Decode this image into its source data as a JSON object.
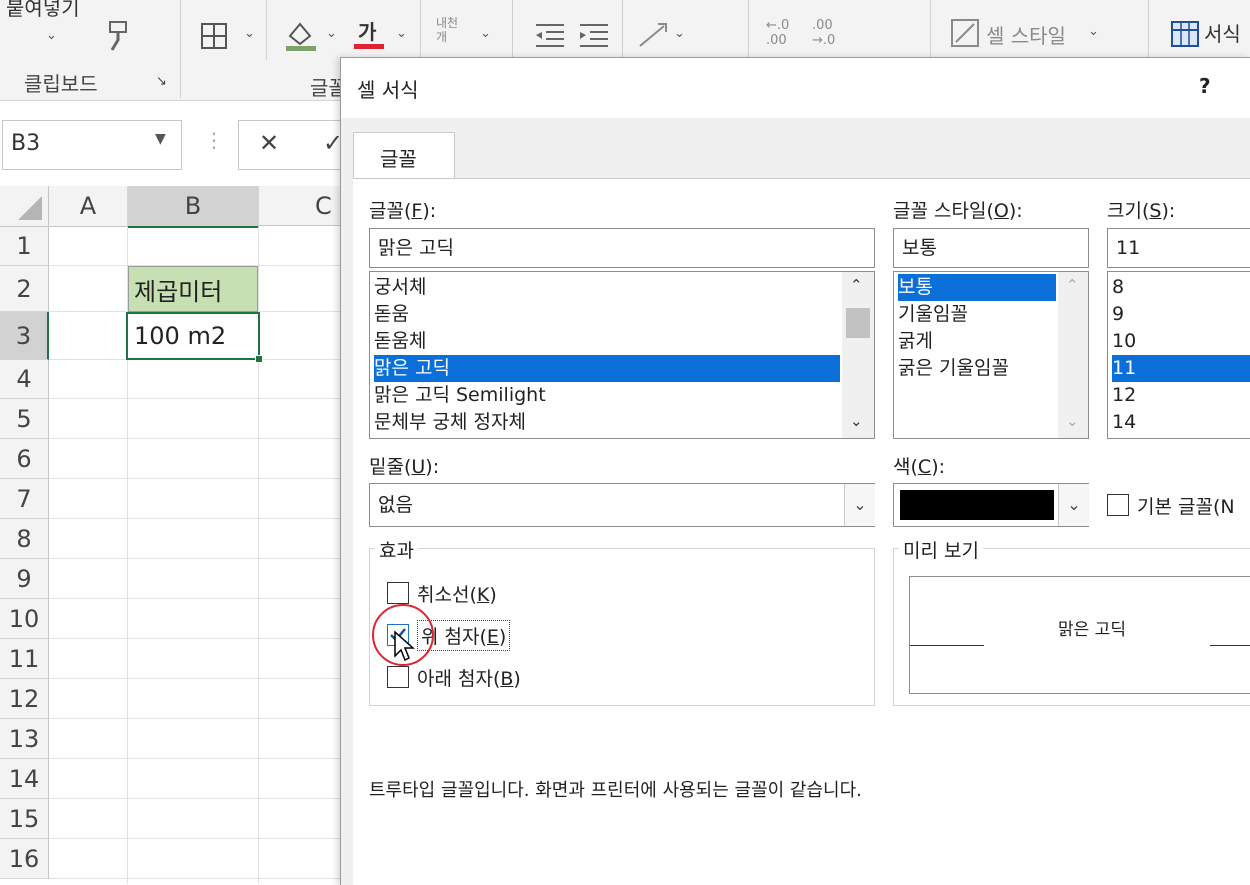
{
  "ribbon": {
    "paste_label": "붙여넣기",
    "clipboard_label": "클립보드",
    "font_group_label": "글꼴",
    "font_color_glyph": "가",
    "wrap_glyph": "내천\n개",
    "cell_style_label": "셀 스타일",
    "format_label": "서식",
    "dec_inc_top": "←.0",
    "dec_inc_bottom": ".00",
    "dec_dec_top": ".00",
    "dec_dec_bottom": "→.0"
  },
  "formula_bar": {
    "name_box": "B3",
    "cancel_glyph": "✕",
    "enter_glyph": "✓"
  },
  "sheet": {
    "columns": [
      "A",
      "B",
      "C"
    ],
    "rows": [
      "1",
      "2",
      "3",
      "4",
      "5",
      "6",
      "7",
      "8",
      "9",
      "10",
      "11",
      "12",
      "13",
      "14",
      "15",
      "16"
    ],
    "cells": {
      "B2": "제곱미터",
      "B3": "100 m2"
    }
  },
  "dialog": {
    "title": "셀 서식",
    "help": "?",
    "tab_font": "글꼴",
    "font_label": "글꼴(",
    "font_label_key": "F",
    "font_label_end": "):",
    "font_value": "맑은 고딕",
    "font_list": [
      "궁서체",
      "돋움",
      "돋움체",
      "맑은 고딕",
      "맑은 고딕 Semilight",
      "문체부 궁체 정자체"
    ],
    "font_selected_index": 3,
    "style_label": "글꼴 스타일(",
    "style_label_key": "O",
    "style_label_end": "):",
    "style_value": "보통",
    "style_list": [
      "보통",
      "기울임꼴",
      "굵게",
      "굵은 기울임꼴"
    ],
    "size_label": "크기(",
    "size_label_key": "S",
    "size_label_end": "):",
    "size_value": "11",
    "size_list": [
      "8",
      "9",
      "10",
      "11",
      "12",
      "14"
    ],
    "underline_label": "밑줄(",
    "underline_key": "U",
    "underline_end": "):",
    "underline_value": "없음",
    "color_label": "색(",
    "color_key": "C",
    "color_end": "):",
    "color_value": "#000000",
    "default_font_label": "기본 글꼴(N",
    "effects_label": "효과",
    "strike_label": "취소선(",
    "strike_key": "K",
    "superscript_label": "위 첨자(",
    "superscript_key": "E",
    "subscript_label": "아래 첨자(",
    "subscript_key": "B",
    "close_paren": ")",
    "preview_label": "미리 보기",
    "preview_text": "맑은 고딕",
    "truetype_note": "트루타입 글꼴입니다. 화면과 프린터에 사용되는 글꼴이 같습니다."
  },
  "colors": {
    "selection": "#0a6fd9",
    "b2_fill": "#c6e0b4",
    "active_border": "#217346",
    "annotation_circle": "#e0242f"
  }
}
